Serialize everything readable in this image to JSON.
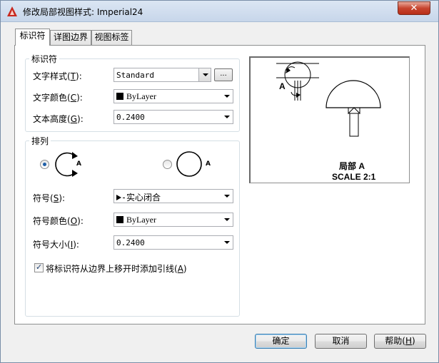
{
  "window": {
    "title": "修改局部视图样式: Imperial24",
    "close_label": "✕"
  },
  "tabs": [
    {
      "label": "标识符"
    },
    {
      "label": "详图边界"
    },
    {
      "label": "视图标签"
    }
  ],
  "identifier_group": {
    "label": "标识符",
    "text_style": {
      "label": "文字样式",
      "key": "T",
      "value": "Standard",
      "browse_label": "..."
    },
    "text_color": {
      "label": "文字颜色",
      "key": "C",
      "value": "ByLayer"
    },
    "text_height": {
      "label": "文本高度",
      "key": "G",
      "value": "0.2400"
    }
  },
  "arrangement_group": {
    "label": "排列",
    "option_left_letter": "A",
    "option_right_letter": "A",
    "selected_option": "left",
    "symbol": {
      "label": "符号",
      "key": "S",
      "value": "实心闭合"
    },
    "symbol_color": {
      "label": "符号颜色",
      "key": "O",
      "value": "ByLayer"
    },
    "symbol_size": {
      "label": "符号大小",
      "key": "I",
      "value": "0.2400"
    },
    "leader_checkbox": {
      "label": "将标识符从边界上移开时添加引线",
      "key": "A",
      "checked": true
    }
  },
  "preview": {
    "letter": "A",
    "caption_line1": "局部  A",
    "caption_line2": "SCALE 2:1"
  },
  "buttons": {
    "ok": "确定",
    "cancel": "取消",
    "help": "帮助",
    "help_key": "H"
  }
}
